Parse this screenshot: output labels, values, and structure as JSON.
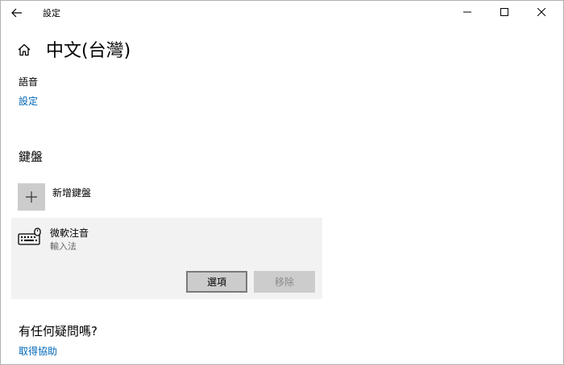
{
  "window": {
    "title": "設定",
    "minimize_icon": "minimize-icon",
    "maximize_icon": "maximize-icon",
    "close_icon": "close-icon",
    "back_icon": "back-arrow-icon"
  },
  "header": {
    "home_icon": "home-icon",
    "title": "中文(台灣)"
  },
  "speech": {
    "label": "語音",
    "settings_link": "設定"
  },
  "keyboard": {
    "heading": "鍵盤",
    "add_label": "新增鍵盤",
    "items": [
      {
        "name": "微軟注音",
        "type": "輸入法",
        "options_label": "選項",
        "remove_label": "移除"
      }
    ]
  },
  "help": {
    "heading": "有任何疑問嗎?",
    "link": "取得協助"
  },
  "colors": {
    "link": "#0067b8",
    "item_bg": "#f2f2f2",
    "tile_bg": "#cccccc"
  }
}
